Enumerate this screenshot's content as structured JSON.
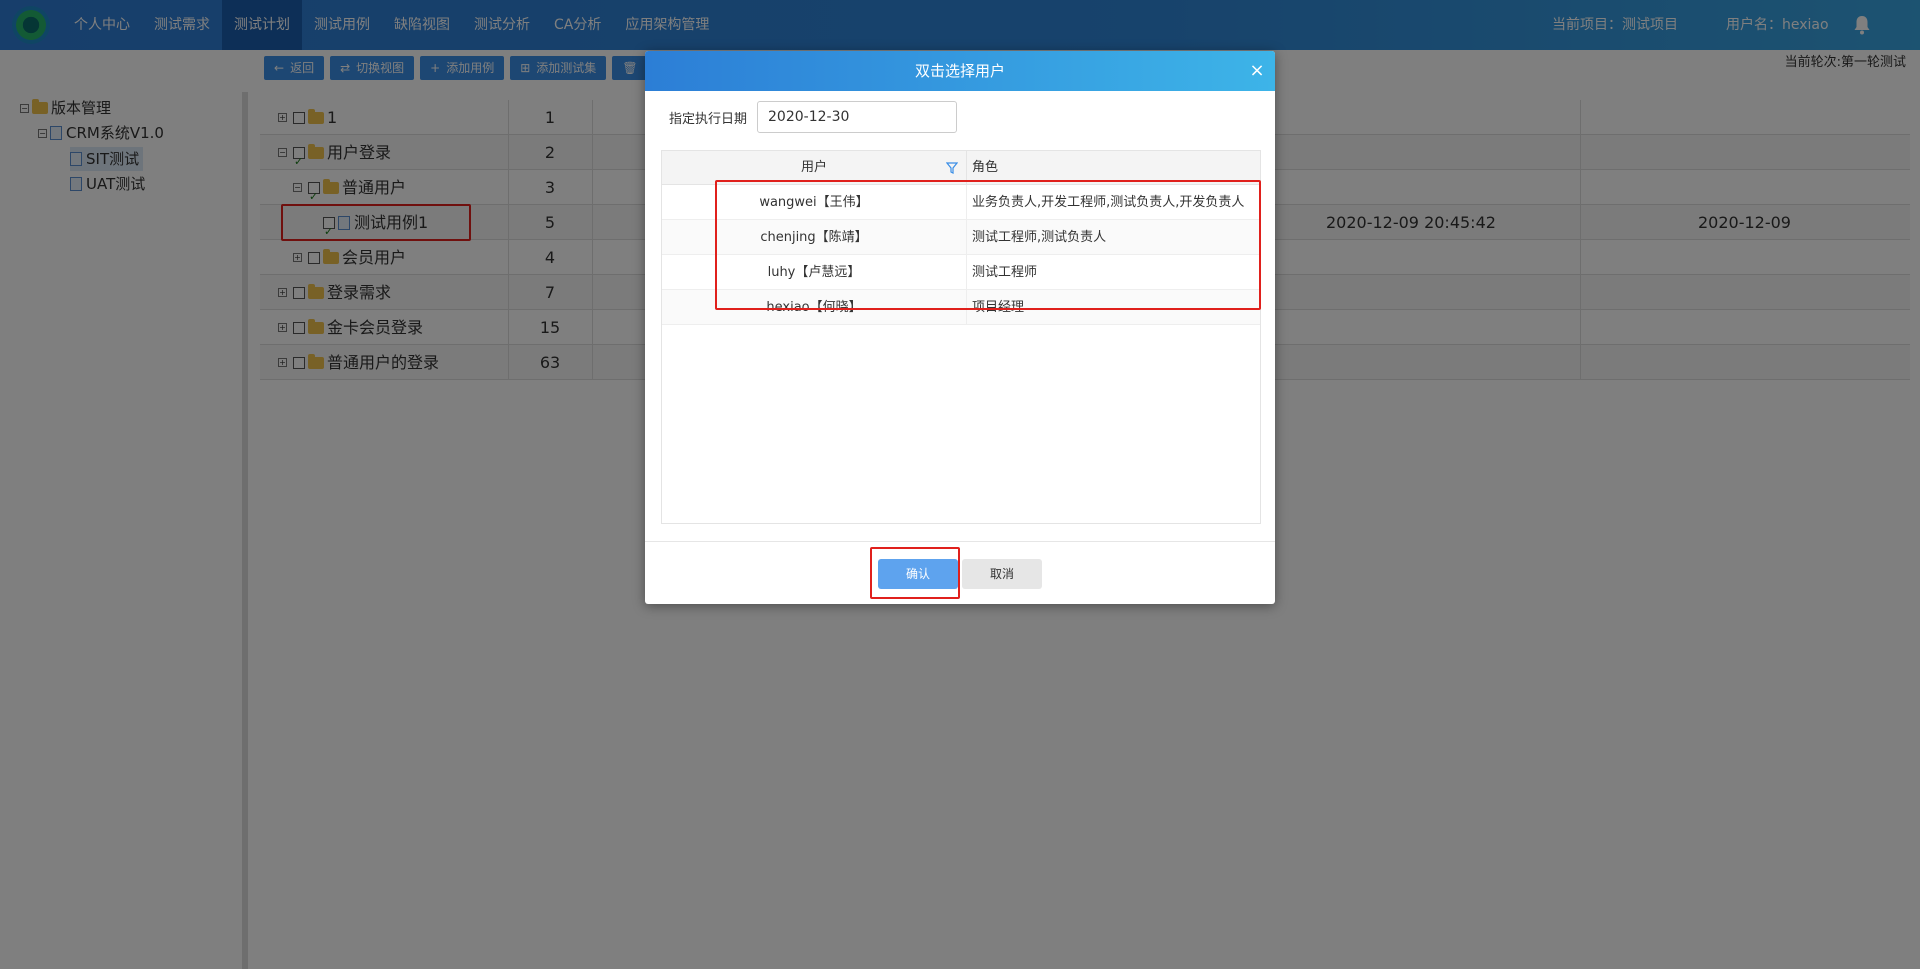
{
  "nav": {
    "items": [
      "个人中心",
      "测试需求",
      "测试计划",
      "测试用例",
      "缺陷视图",
      "测试分析",
      "CA分析",
      "应用架构管理"
    ],
    "active_index": 2,
    "project_text": "当前项目：测试项目",
    "user_text": "用户名：hexiao",
    "round_text": "当前轮次:第一轮测试"
  },
  "toolbar": {
    "back": "返回",
    "switch_view": "切换视图",
    "add_case": "添加用例",
    "add_set": "添加测试集"
  },
  "tree": {
    "root": "版本管理",
    "version": "CRM系统V1.0",
    "sit": "SIT测试",
    "uat": "UAT测试"
  },
  "grid": {
    "rows": [
      {
        "name": "1",
        "id": "1"
      },
      {
        "name": "用户登录",
        "id": "2"
      },
      {
        "name": "普通用户",
        "id": "3"
      },
      {
        "name": "测试用例1",
        "id": "5",
        "datetime": "2020-12-09 20:45:42",
        "date": "2020-12-09"
      },
      {
        "name": "会员用户",
        "id": "4"
      },
      {
        "name": "登录需求",
        "id": "7"
      },
      {
        "name": "金卡会员登录",
        "id": "15"
      },
      {
        "name": "普通用户的登录",
        "id": "63"
      }
    ]
  },
  "modal": {
    "title": "双击选择用户",
    "close": "×",
    "date_label": "指定执行日期",
    "date_value": "2020-12-30",
    "col_user": "用户",
    "col_role": "角色",
    "users": [
      {
        "user": "wangwei【王伟】",
        "role": "业务负责人,开发工程师,测试负责人,开发负责人"
      },
      {
        "user": "chenjing【陈靖】",
        "role": "测试工程师,测试负责人"
      },
      {
        "user": "luhy【卢慧远】",
        "role": "测试工程师"
      },
      {
        "user": "hexiao【何晓】",
        "role": "项目经理"
      }
    ],
    "ok": "确认",
    "cancel": "取消"
  }
}
